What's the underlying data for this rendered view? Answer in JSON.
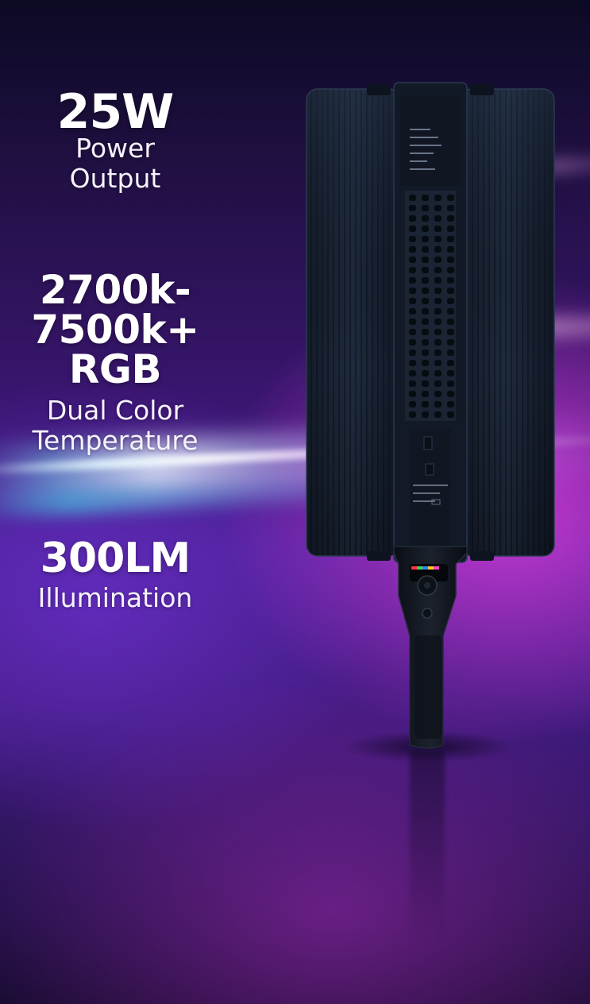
{
  "specs": [
    {
      "value": "25W",
      "label_line1": "Power",
      "label_line2": "Output"
    },
    {
      "value_line1": "2700k-",
      "value_line2": "7500k+",
      "value_line3": "RGB",
      "label_line1": "Dual Color",
      "label_line2": "Temperature"
    },
    {
      "value": "300LM",
      "label_line1": "Illumination"
    }
  ],
  "product": {
    "name": "LED light panel with handle",
    "panel_color": "#1b2535",
    "led_indicator_colors": [
      "#ff3344",
      "#33dd55",
      "#3388ff",
      "#ffcc22",
      "#ff44cc"
    ]
  },
  "colors": {
    "background_top": "#0c0a24",
    "background_mid": "#4a1f94",
    "accent_magenta": "#dc3cdc",
    "text": "#ffffff"
  }
}
